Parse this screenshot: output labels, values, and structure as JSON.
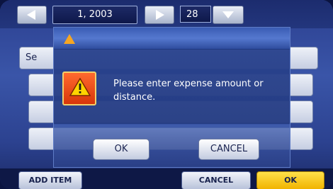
{
  "header": {
    "date_label": "1, 2003",
    "day_value": "28"
  },
  "background_list": {
    "first_row_label_partial": "Se"
  },
  "dialog": {
    "message": "Please enter expense amount or distance.",
    "ok_label": "OK",
    "cancel_label": "CANCEL"
  },
  "bottom_bar": {
    "add_item_label": "ADD ITEM",
    "cancel_label": "CANCEL",
    "ok_label": "OK"
  },
  "icons": [
    "prev-arrow-icon",
    "next-arrow-icon",
    "dropdown-arrow-icon",
    "warning-icon"
  ],
  "colors": {
    "accent_ok": "#f1b300",
    "warning": "#e24a14",
    "screen_blue": "#2c4290"
  }
}
